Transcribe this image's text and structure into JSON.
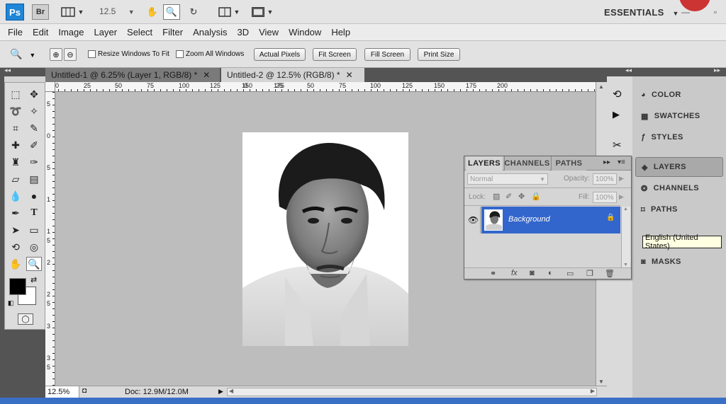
{
  "app": {
    "logo": "Ps",
    "bridge": "Br",
    "zoom_level": "12.5",
    "workspace": "ESSENTIALS"
  },
  "menu": [
    "File",
    "Edit",
    "Image",
    "Layer",
    "Select",
    "Filter",
    "Analysis",
    "3D",
    "View",
    "Window",
    "Help"
  ],
  "options": {
    "resize_windows": "Resize Windows To Fit",
    "zoom_all": "Zoom All Windows",
    "actual_pixels": "Actual Pixels",
    "fit_screen": "Fit Screen",
    "fill_screen": "Fill Screen",
    "print_size": "Print Size"
  },
  "tabs": [
    {
      "label": "Untitled-1 @ 6.25% (Layer 1, RGB/8) *"
    },
    {
      "label": "Untitled-2 @ 12.5% (RGB/8) *"
    }
  ],
  "ruler_top": [
    "0",
    "25",
    "50",
    "75",
    "100",
    "125",
    "150",
    "175",
    "0",
    "25",
    "50",
    "75",
    "100",
    "125",
    "150",
    "175",
    "200"
  ],
  "ruler_left": [
    "5",
    "0",
    "5",
    "1",
    "1",
    "5",
    "2",
    "2",
    "5",
    "3",
    "3",
    "5"
  ],
  "status": {
    "zoom": "12.5%",
    "doc": "Doc: 12.9M/12.0M"
  },
  "dock_panels": [
    "COLOR",
    "SWATCHES",
    "STYLES",
    "LAYERS",
    "CHANNELS",
    "PATHS",
    "MASKS"
  ],
  "layers_panel": {
    "tabs": [
      "LAYERS",
      "CHANNELS",
      "PATHS"
    ],
    "blend_mode": "Normal",
    "opacity_label": "Opacity:",
    "opacity_value": "100%",
    "lock_label": "Lock:",
    "fill_label": "Fill:",
    "fill_value": "100%",
    "layer_name": "Background"
  },
  "tooltip": "English (United States)",
  "colors": {
    "accent": "#3366cc",
    "ps_blue": "#1f86d8",
    "canvas_bg": "#bdbdbd"
  }
}
